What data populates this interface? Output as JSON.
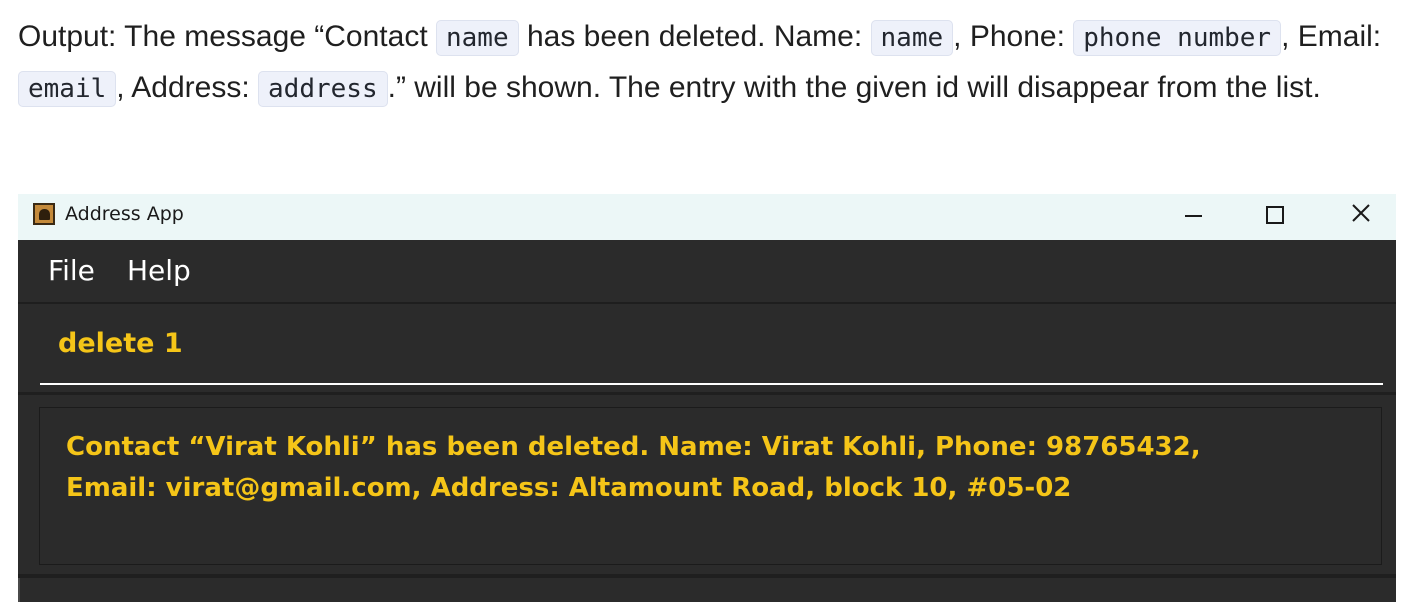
{
  "doc": {
    "t1": "Output: The message “Contact ",
    "c1": "name",
    "t2": " has been deleted. Name: ",
    "c2": "name",
    "t3": ", Phone: ",
    "c3": "phone number",
    "t4": ", Email: ",
    "c4": "email",
    "t5": ", Address: ",
    "c5": "address",
    "t6": ".” will be shown. The entry with the given id will disappear from the list."
  },
  "window": {
    "title": "Address App",
    "icons": {
      "app": "address-book-icon",
      "minimize": "minimize-icon",
      "maximize": "maximize-icon",
      "close": "close-icon"
    }
  },
  "menu": {
    "file": "File",
    "help": "Help"
  },
  "command": {
    "value": "delete 1"
  },
  "result": {
    "line1": "Contact “Virat Kohli” has been deleted. Name: Virat Kohli, Phone: 98765432,",
    "line2": "Email: virat@gmail.com, Address: Altamount Road, block 10, #05-02"
  },
  "colors": {
    "window_bg": "#2b2b2b",
    "titlebar_bg": "#ecf7f7",
    "accent_text": "#f5c518",
    "code_bg": "#eef1fa"
  }
}
